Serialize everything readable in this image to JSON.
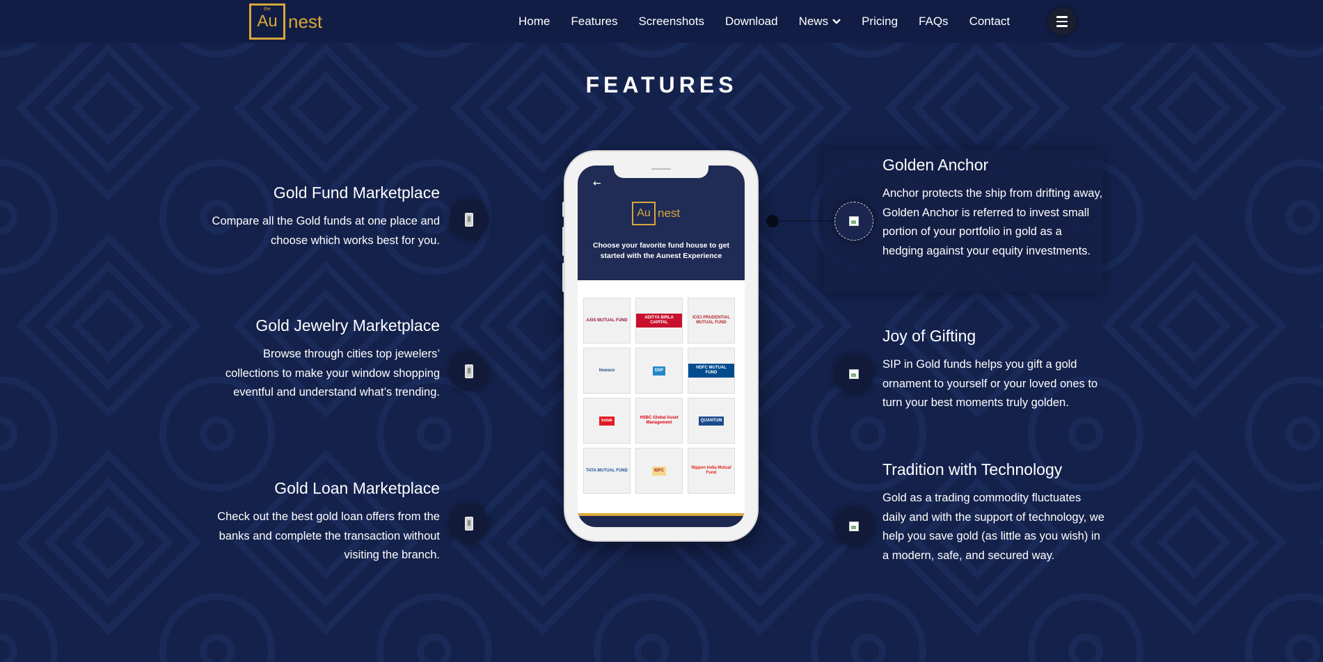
{
  "brand": {
    "logo_prefix": "the",
    "logo_box": "Au",
    "logo_suffix": "nest"
  },
  "nav": {
    "items": [
      {
        "label": "Home"
      },
      {
        "label": "Features"
      },
      {
        "label": "Screenshots"
      },
      {
        "label": "Download"
      },
      {
        "label": "News"
      },
      {
        "label": "Pricing"
      },
      {
        "label": "FAQs"
      },
      {
        "label": "Contact"
      }
    ]
  },
  "section": {
    "title": "FEATURES"
  },
  "features_left": [
    {
      "title": "Gold Fund Marketplace",
      "text": "Compare all the Gold funds at one place and choose which works best for you."
    },
    {
      "title": "Gold Jewelry Marketplace",
      "text": "Browse through cities top jewelers’ collections to make your window shopping eventful and understand what’s trending."
    },
    {
      "title": "Gold Loan Marketplace",
      "text": "Check out the best gold loan offers from the banks and complete the transaction without visiting the branch."
    }
  ],
  "features_right": [
    {
      "title": "Golden Anchor",
      "text": "Anchor protects the ship from drifting away, Golden Anchor is referred to invest small portion of your portfolio in gold as a hedging against your equity investments."
    },
    {
      "title": "Joy of Gifting",
      "text": "SIP in Gold funds helps you gift a gold ornament to yourself or your loved ones to turn your best moments truly golden."
    },
    {
      "title": "Tradition with Technology",
      "text": "Gold as a trading commodity fluctuates daily and with the support of technology, we help you save gold (as little as you wish) in a modern, safe, and secured way."
    }
  ],
  "phone_screen": {
    "back_icon": "arrow-left-icon",
    "logo_box": "Au",
    "logo_suffix": "nest",
    "tagline": "Choose your favorite fund house to get started with the Aunest Experience",
    "fund_tiles": [
      {
        "label": "AXIS MUTUAL FUND",
        "color": "#97144d",
        "bg": "#f1f1f1"
      },
      {
        "label": "ADITYA BIRLA CAPITAL",
        "color": "#ffffff",
        "bg": "#c8102e"
      },
      {
        "label": "ICICI PRUDENTIAL MUTUAL FUND",
        "color": "#b02a30",
        "bg": "#f1f1f1"
      },
      {
        "label": "Invesco",
        "color": "#1f3c88",
        "bg": "#f1f1f1"
      },
      {
        "label": "DSP",
        "color": "#ffffff",
        "bg": "#1e88c8"
      },
      {
        "label": "HDFC MUTUAL FUND",
        "color": "#ffffff",
        "bg": "#004c8f"
      },
      {
        "label": "kotak",
        "color": "#ffffff",
        "bg": "#e11b22"
      },
      {
        "label": "HSBC Global Asset Management",
        "color": "#db0011",
        "bg": "#f1f1f1"
      },
      {
        "label": "QUANTUM",
        "color": "#ffffff",
        "bg": "#1b4b8f"
      },
      {
        "label": "TATA MUTUAL FUND",
        "color": "#1f4e9c",
        "bg": "#f1f1f1"
      },
      {
        "label": "IDFC",
        "color": "#9d1d27",
        "bg": "#f5d88c"
      },
      {
        "label": "Nippon India Mutual Fund",
        "color": "#e2231a",
        "bg": "#f1f1f1"
      }
    ]
  },
  "colors": {
    "background": "#14214a",
    "gold": "#d9a83b",
    "header": "#111d44"
  }
}
